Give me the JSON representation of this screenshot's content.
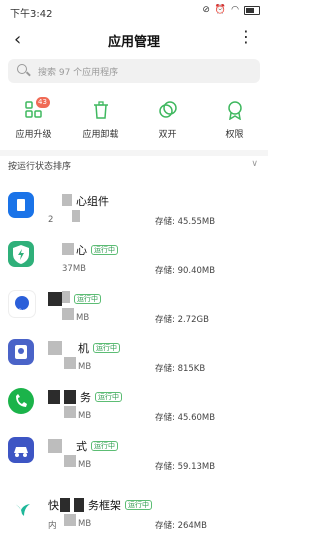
{
  "status_bar": {
    "time": "下午3:42",
    "icons": [
      "mute-icon",
      "alarm-icon",
      "wifi-icon",
      "battery-icon"
    ]
  },
  "header": {
    "title": "应用管理",
    "back_label": "‹",
    "menu_label": "⋮"
  },
  "search": {
    "placeholder": "搜索 97 个应用程序"
  },
  "actions": [
    {
      "label": "应用升级",
      "badge": "43"
    },
    {
      "label": "应用卸载"
    },
    {
      "label": "双开"
    },
    {
      "label": "权限"
    }
  ],
  "sort": {
    "label": "按运行状态排序"
  },
  "apps": [
    {
      "name": "心组件",
      "size": "2",
      "storage": "存储: 45.55MB",
      "running": ""
    },
    {
      "name": "心",
      "size": "37MB",
      "storage": "存储: 90.40MB",
      "running": "运行中"
    },
    {
      "name": "",
      "size": "MB",
      "storage": "存储: 2.72GB",
      "running": "运行中"
    },
    {
      "name": "机",
      "size": "MB",
      "storage": "存储: 815KB",
      "running": "运行中"
    },
    {
      "name": "务",
      "size": "MB",
      "storage": "存储: 45.60MB",
      "running": "运行中"
    },
    {
      "name": "式",
      "size": "MB",
      "storage": "存储: 59.13MB",
      "running": "运行中"
    },
    {
      "name": "快",
      "name_suffix": "务框架",
      "size": "内",
      "size_suffix": "MB",
      "storage": "存储: 264MB",
      "running": "运行中"
    }
  ],
  "colors": {
    "accent_green": "#3fb85f",
    "running_tag": "#2e9b4e",
    "badge": "#f06a55"
  }
}
